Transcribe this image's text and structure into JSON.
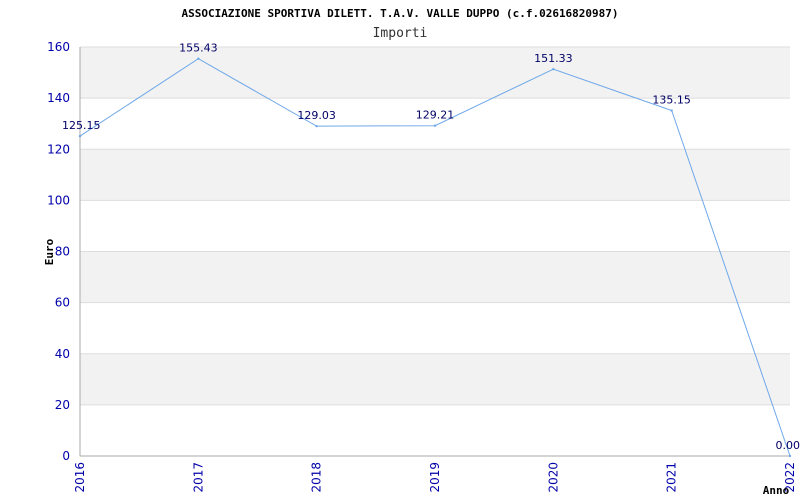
{
  "colors": {
    "band": "#f2f2f2",
    "grid": "#dddddd",
    "axis": "#aaaaaa",
    "line": "#6fa8e8",
    "tick_text": "#0000aa",
    "data_label": "#000066"
  },
  "chart_data": {
    "type": "line",
    "title": "ASSOCIAZIONE SPORTIVA DILETT. T.A.V. VALLE DUPPO (c.f.02616820987)",
    "subtitle": "Importi",
    "xlabel": "Anno",
    "ylabel": "Euro",
    "x": [
      "2016",
      "2017",
      "2018",
      "2019",
      "2020",
      "2021",
      "2022"
    ],
    "series": [
      {
        "values": [
          125.15,
          155.43,
          129.03,
          129.21,
          151.33,
          135.15,
          0.0
        ],
        "labels": [
          "125.15",
          "155.43",
          "129.03",
          "129.21",
          "151.33",
          "135.15",
          "0.00"
        ]
      }
    ],
    "ylim": [
      0,
      160
    ],
    "yticks": [
      "0",
      "20",
      "40",
      "60",
      "80",
      "100",
      "120",
      "140",
      "160"
    ],
    "grid": true,
    "legend": "none"
  }
}
